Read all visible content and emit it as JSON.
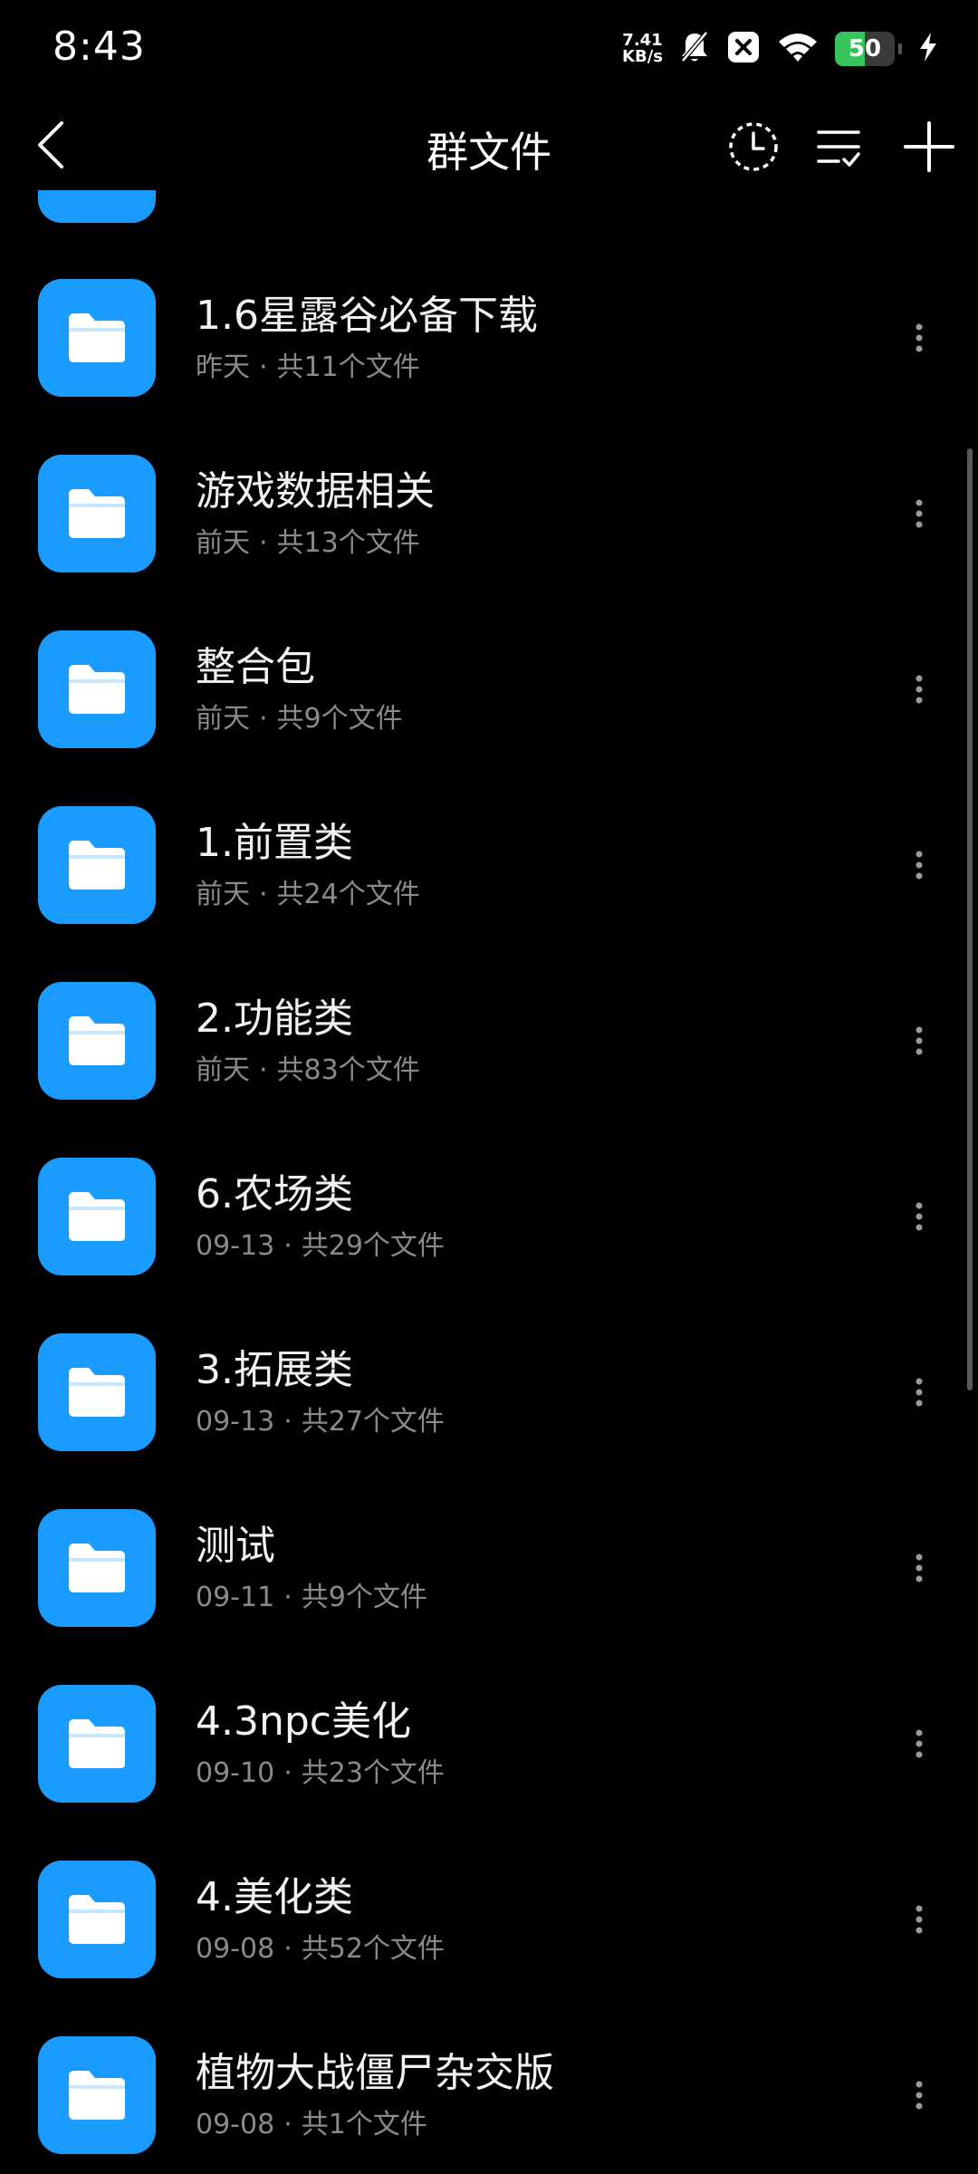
{
  "status_bar": {
    "time": "8:43",
    "net_speed_value": "7.41",
    "net_speed_unit": "KB/s",
    "battery_level": "50",
    "icons": [
      "mute-icon",
      "notification-x-icon",
      "wifi-icon",
      "battery-icon",
      "charging-icon"
    ],
    "battery_color": "#35c55b"
  },
  "header": {
    "title": "群文件",
    "actions": [
      "history-icon",
      "sort-icon",
      "add-icon"
    ]
  },
  "colors": {
    "folder": "#1a9bff",
    "background": "#000000",
    "secondary_text": "#8a8a8a"
  },
  "folders": [
    {
      "name": "1.6星露谷必备下载",
      "date": "昨天",
      "count": "共11个文件"
    },
    {
      "name": "游戏数据相关",
      "date": "前天",
      "count": "共13个文件"
    },
    {
      "name": "整合包",
      "date": "前天",
      "count": "共9个文件"
    },
    {
      "name": "1.前置类",
      "date": "前天",
      "count": "共24个文件"
    },
    {
      "name": "2.功能类",
      "date": "前天",
      "count": "共83个文件"
    },
    {
      "name": "6.农场类",
      "date": "09-13",
      "count": "共29个文件"
    },
    {
      "name": "3.拓展类",
      "date": "09-13",
      "count": "共27个文件"
    },
    {
      "name": "测试",
      "date": "09-11",
      "count": "共9个文件"
    },
    {
      "name": "4.3npc美化",
      "date": "09-10",
      "count": "共23个文件"
    },
    {
      "name": "4.美化类",
      "date": "09-08",
      "count": "共52个文件"
    },
    {
      "name": "植物大战僵尸杂交版",
      "date": "09-08",
      "count": "共1个文件"
    }
  ],
  "meta_separator": "·"
}
